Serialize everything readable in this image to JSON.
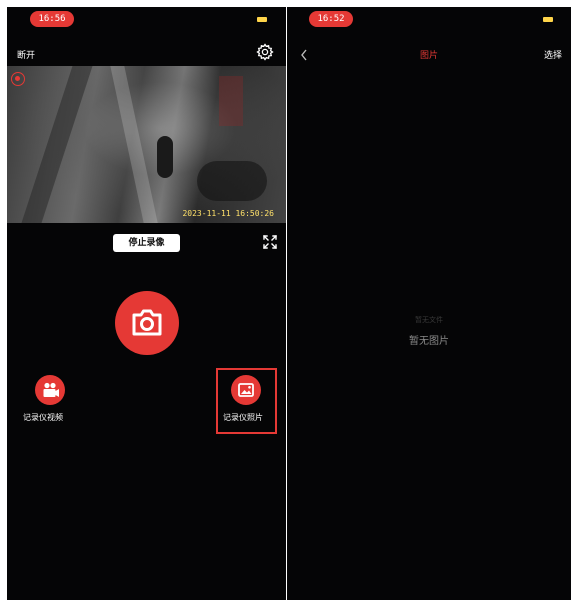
{
  "left_screen": {
    "status_time": "16:56",
    "disconnect_label": "断开",
    "video_timestamp": "2023-11-11 16:50:26",
    "stop_recording_label": "停止录像",
    "album_left_label": "记录仪视频",
    "album_right_label": "记录仪照片"
  },
  "right_screen": {
    "status_time": "16:52",
    "title": "图片",
    "select_label": "选择",
    "empty_hint": "暂无文件",
    "empty_message": "暂无图片"
  },
  "colors": {
    "accent": "#e53935",
    "background": "#050506",
    "battery": "#ffd54a",
    "timestamp": "#ffe16a"
  },
  "icons": [
    "gear-icon",
    "record-indicator-icon",
    "fullscreen-icon",
    "camera-icon",
    "video-icon",
    "photo-icon",
    "back-arrow-icon"
  ]
}
